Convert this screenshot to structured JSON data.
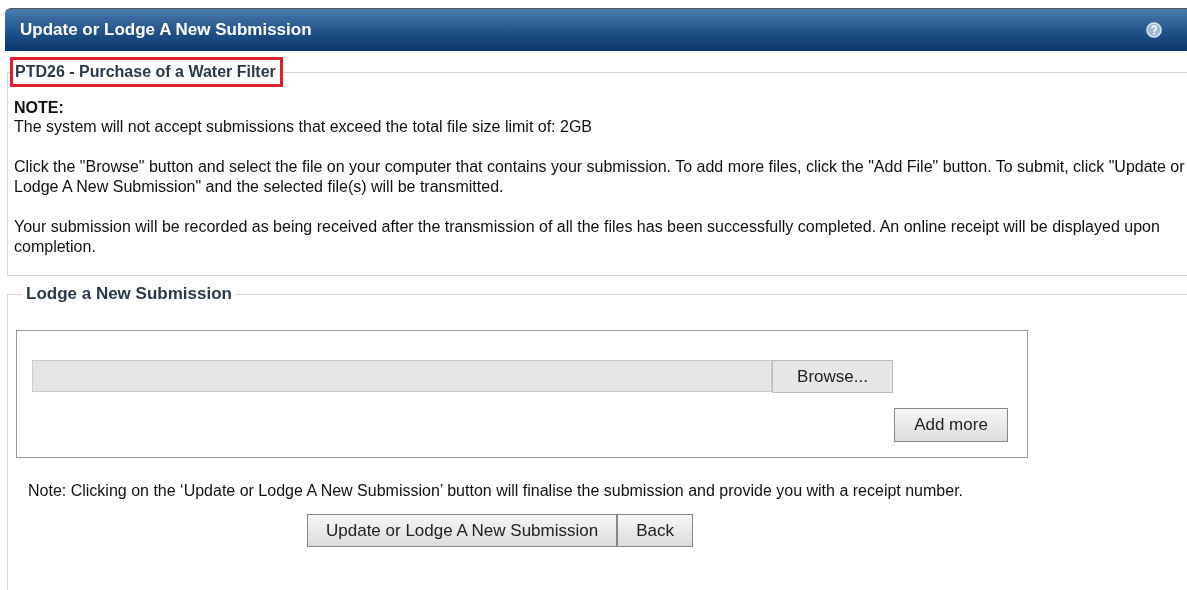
{
  "header": {
    "title": "Update or Lodge A New Submission"
  },
  "details": {
    "legend": "PTD26 - Purchase of a Water Filter",
    "note_heading": "NOTE:",
    "paragraphs": [
      "The system will not accept submissions that exceed the total file size limit of: 2GB",
      "Click the \"Browse\" button and select the file on your computer that contains your submission. To add more files, click the \"Add File\" button. To submit, click \"Update or Lodge A New Submission\" and the selected file(s) will be transmitted.",
      "Your submission will be recorded as being received after the transmission of all the files has been successfully completed. An online receipt will be displayed upon completion."
    ]
  },
  "lodge": {
    "legend": "Lodge a New Submission",
    "browse_button": "Browse...",
    "add_button": "Add more",
    "note": "Note: Clicking on the ‘Update or Lodge A New Submission’ button will finalise the submission and provide you with a receipt number.",
    "buttons": [
      "Update or Lodge A New Submission",
      "Back"
    ]
  }
}
